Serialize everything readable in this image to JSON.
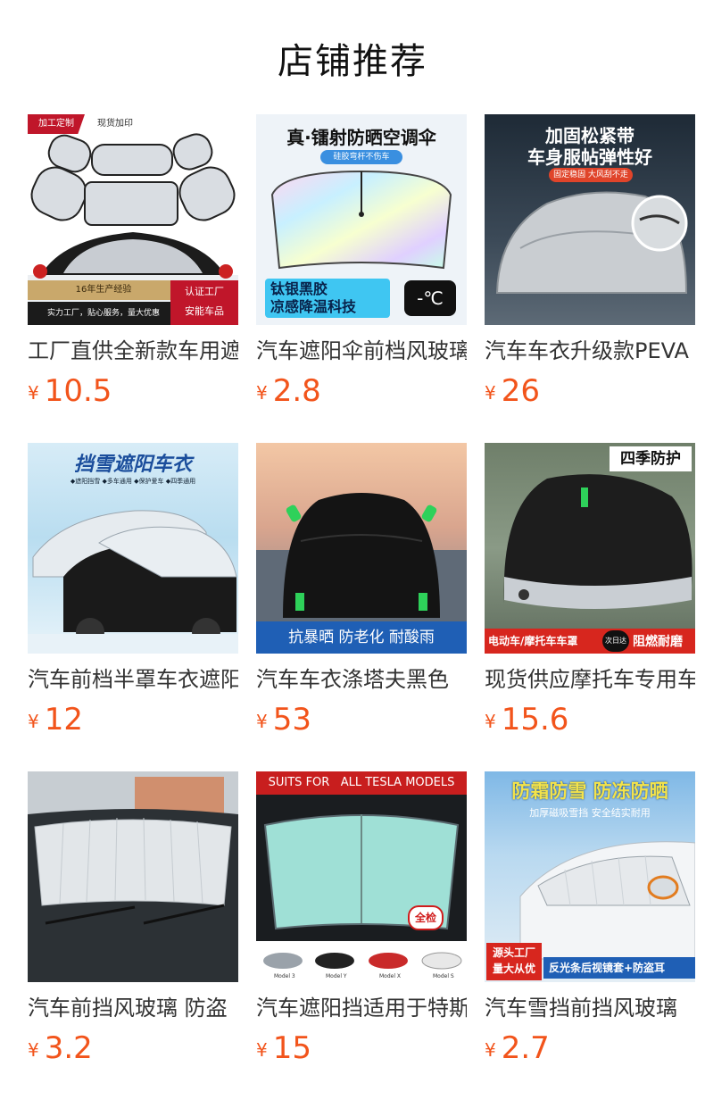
{
  "page": {
    "title": "店铺推荐"
  },
  "products": [
    {
      "name": "工厂直供全新款车用遮阳挡",
      "currency": "¥",
      "price": "10.5",
      "tags": [
        "加工定制",
        "现货加印"
      ],
      "badge1": "16年生产经验",
      "badge2": "实力工厂，贴心服务，量大优惠",
      "badge3": "认证工厂",
      "badge4": "安能车品"
    },
    {
      "name": "汽车遮阳伞前档风玻璃",
      "currency": "¥",
      "price": "2.8",
      "head": "真·镭射防晒空调伞",
      "sub": "硅胶弯杆不伤车",
      "feature1": "钛银黑胶",
      "feature2": "凉感降温科技",
      "icon_text": "-℃"
    },
    {
      "name": "汽车车衣升级款PEVA",
      "currency": "¥",
      "price": "26",
      "head1": "加固松紧带",
      "head2": "车身服帖弹性好",
      "sub": "固定稳固 大风刮不走"
    },
    {
      "name": "汽车前档半罩车衣遮阳",
      "currency": "¥",
      "price": "12",
      "head": "挡雪遮阳车衣",
      "sub": "◆遮阳挡雪 ◆多车通用 ◆保护爱车 ◆四季通用"
    },
    {
      "name": "汽车车衣涤塔夫黑色",
      "currency": "¥",
      "price": "53",
      "banner": "抗暴晒 防老化 耐酸雨"
    },
    {
      "name": "现货供应摩托车专用车罩",
      "currency": "¥",
      "price": "15.6",
      "corner": "四季防护",
      "banner1": "电动车/摩托车车罩",
      "logo": "次日达",
      "banner2": "阻燃耐磨"
    },
    {
      "name": "汽车前挡风玻璃 防盗",
      "currency": "¥",
      "price": "3.2"
    },
    {
      "name": "汽车遮阳挡适用于特斯拉",
      "currency": "¥",
      "price": "15",
      "head": "SUITS FOR   ALL TESLA MODELS",
      "stamp": "全检",
      "models": [
        "Model 3",
        "Model Y",
        "Model X",
        "Model S"
      ]
    },
    {
      "name": "汽车雪挡前挡风玻璃",
      "currency": "¥",
      "price": "2.7",
      "head": "防霜防雪 防冻防晒",
      "sub": "加厚磁吸雪挡 安全结实耐用",
      "corner1": "源头工厂",
      "corner2": "量大从优",
      "banner": "反光条后视镜套+防盗耳"
    }
  ]
}
